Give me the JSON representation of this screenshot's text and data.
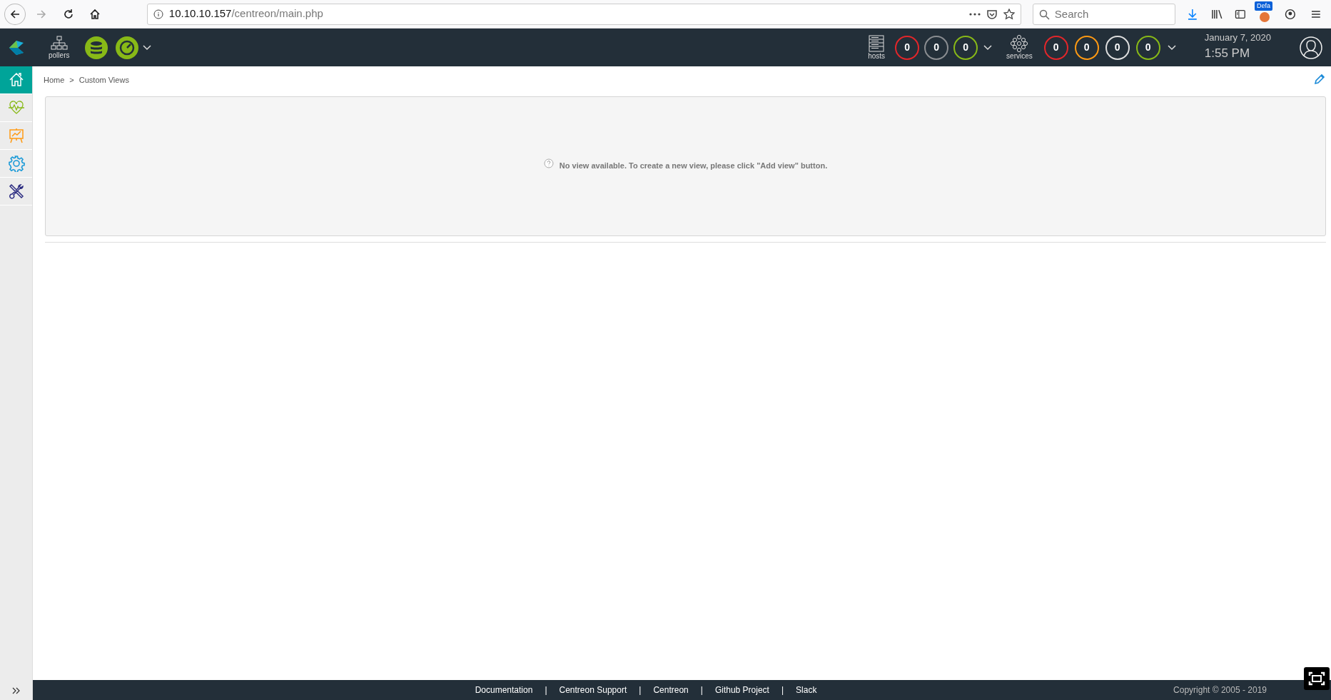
{
  "browser": {
    "url_host": "10.10.10.157",
    "url_path": "/centreon/main.php",
    "search_placeholder": "Search",
    "profile_badge": "Defa"
  },
  "header": {
    "pollers_label": "pollers",
    "hosts_label": "hosts",
    "host_counts": [
      {
        "value": "0",
        "color": "#e3262a"
      },
      {
        "value": "0",
        "color": "#8a8d91"
      },
      {
        "value": "0",
        "color": "#88b917"
      }
    ],
    "services_label": "services",
    "service_counts": [
      {
        "value": "0",
        "color": "#e3262a"
      },
      {
        "value": "0",
        "color": "#ff9a13"
      },
      {
        "value": "0",
        "color": "#dddddd"
      },
      {
        "value": "0",
        "color": "#88b917"
      }
    ],
    "date": "January 7, 2020",
    "time": "1:55 PM"
  },
  "sidebar": {
    "items": [
      {
        "kind": "home",
        "selected": true
      },
      {
        "kind": "monitoring",
        "selected": false
      },
      {
        "kind": "reporting",
        "selected": false
      },
      {
        "kind": "configuration",
        "selected": false
      },
      {
        "kind": "administration",
        "selected": false
      }
    ]
  },
  "breadcrumb": {
    "items": [
      "Home",
      "Custom Views"
    ],
    "separator": ">"
  },
  "message": "No view available. To create a new view, please click \"Add view\" button.",
  "footer": {
    "links": [
      "Documentation",
      "Centreon Support",
      "Centreon",
      "Github Project",
      "Slack"
    ],
    "separator": "|",
    "copyright": "Copyright © 2005 - 2019"
  }
}
